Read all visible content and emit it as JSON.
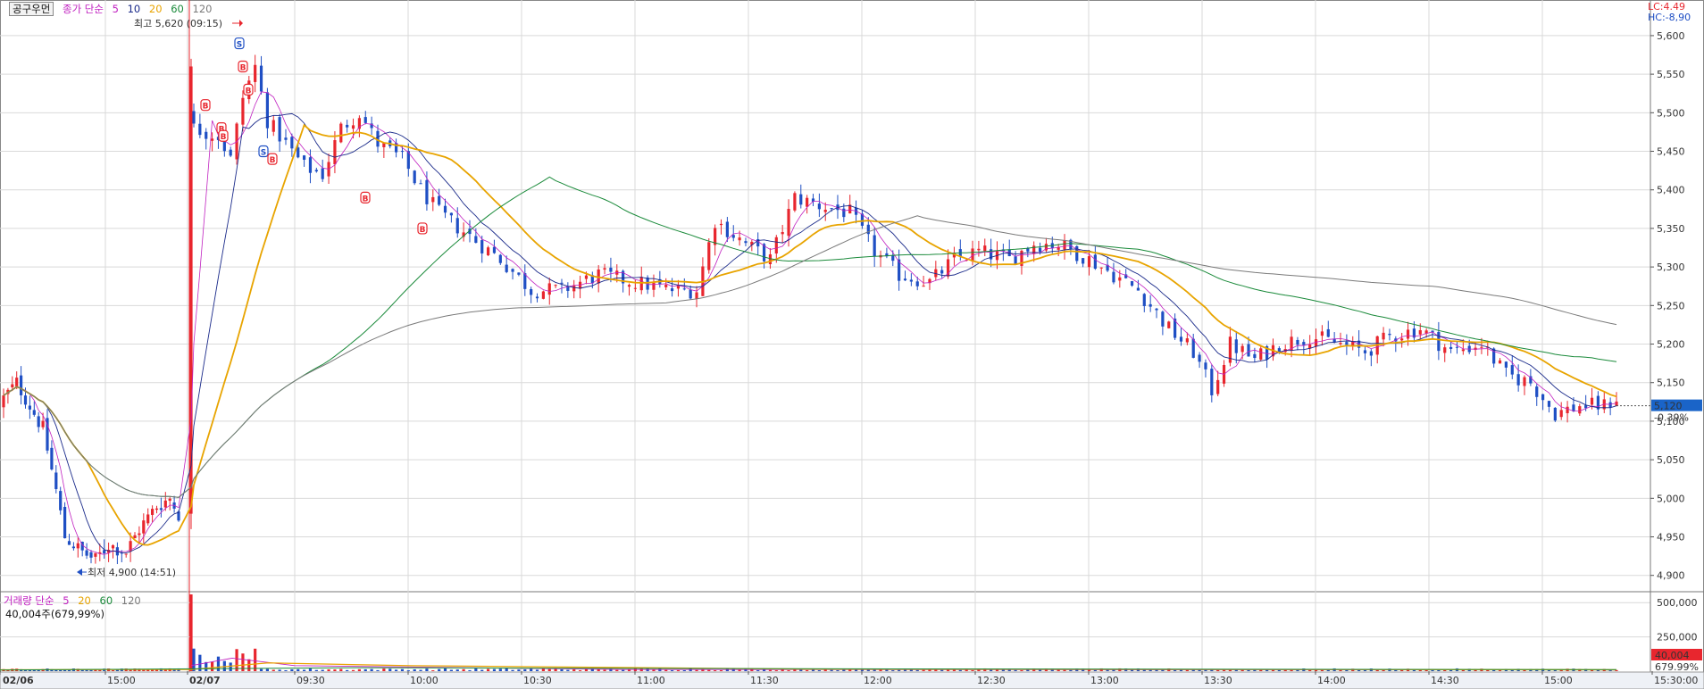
{
  "chart_data": {
    "type": "candlestick",
    "symbol": "공구우먼",
    "colors": {
      "up": "#e8262e",
      "down": "#1f4fc4",
      "ma5": "#c020c0",
      "ma10": "#1a2a8a",
      "ma20": "#e8a400",
      "ma60": "#1a8a3a",
      "ma120": "#7a7a7a",
      "grid": "#d9d9d9",
      "current_box": "#1a64c8",
      "vol_box": "#e8262e"
    },
    "price_legend": {
      "label": "종가 단순",
      "periods": [
        "5",
        "10",
        "20",
        "60",
        "120"
      ]
    },
    "volume_legend": {
      "label": "거래량 단순",
      "periods": [
        "5",
        "20",
        "60",
        "120"
      ],
      "current_text": "40,004주(679,99%)"
    },
    "y_axis": {
      "ticks": [
        "5,600",
        "5,550",
        "5,500",
        "5,450",
        "5,400",
        "5,350",
        "5,300",
        "5,250",
        "5,200",
        "5,150",
        "5,100",
        "5,050",
        "5,000",
        "4,950",
        "4,900"
      ],
      "range": [
        4880,
        5630
      ]
    },
    "vol_axis": {
      "ticks": [
        "500,000",
        "250,000"
      ],
      "range": [
        0,
        560000
      ]
    },
    "x_axis": {
      "ticks": [
        "02/06",
        "15:00",
        "02/07",
        "09:30",
        "10:00",
        "10:30",
        "11:00",
        "11:30",
        "12:00",
        "12:30",
        "13:00",
        "13:30",
        "14:00",
        "14:30",
        "15:00",
        "15:30:00"
      ]
    },
    "annotations": {
      "high": "최고 5,620 (09:15)",
      "low": "최저 4,900 (14:51)",
      "lc": "LC:4.49",
      "hc": "HC:-8,90",
      "current_price": "5,120",
      "current_change": "-0.39%",
      "current_volume": "40,004",
      "current_volume_pct": "679.99%"
    },
    "signals": {
      "buy": "B",
      "sell": "S"
    },
    "waypoints_day1": [
      [
        0,
        5130
      ],
      [
        3,
        5150
      ],
      [
        6,
        5120
      ],
      [
        9,
        5090
      ],
      [
        12,
        5010
      ],
      [
        14,
        4950
      ],
      [
        18,
        4930
      ],
      [
        21,
        4920
      ],
      [
        24,
        4940
      ],
      [
        28,
        4930
      ],
      [
        31,
        4960
      ],
      [
        35,
        4990
      ],
      [
        38,
        5000
      ],
      [
        40,
        4980
      ]
    ],
    "waypoints_day2": [
      [
        0,
        5480
      ],
      [
        4,
        5470
      ],
      [
        6,
        5440
      ],
      [
        8,
        5520
      ],
      [
        10,
        5560
      ],
      [
        12,
        5490
      ],
      [
        14,
        5470
      ],
      [
        18,
        5430
      ],
      [
        21,
        5420
      ],
      [
        24,
        5480
      ],
      [
        27,
        5500
      ],
      [
        30,
        5460
      ],
      [
        34,
        5440
      ],
      [
        37,
        5400
      ],
      [
        40,
        5370
      ],
      [
        45,
        5340
      ],
      [
        50,
        5310
      ],
      [
        55,
        5270
      ],
      [
        60,
        5270
      ],
      [
        66,
        5290
      ],
      [
        72,
        5280
      ],
      [
        78,
        5270
      ],
      [
        82,
        5270
      ],
      [
        85,
        5360
      ],
      [
        90,
        5330
      ],
      [
        94,
        5310
      ],
      [
        98,
        5390
      ],
      [
        102,
        5380
      ],
      [
        107,
        5370
      ],
      [
        111,
        5320
      ],
      [
        115,
        5290
      ],
      [
        120,
        5280
      ],
      [
        124,
        5310
      ],
      [
        128,
        5320
      ],
      [
        133,
        5310
      ],
      [
        137,
        5330
      ],
      [
        141,
        5330
      ],
      [
        146,
        5310
      ],
      [
        150,
        5290
      ],
      [
        154,
        5270
      ],
      [
        159,
        5220
      ],
      [
        163,
        5190
      ],
      [
        166,
        5140
      ],
      [
        169,
        5200
      ],
      [
        173,
        5180
      ],
      [
        177,
        5200
      ],
      [
        182,
        5210
      ],
      [
        187,
        5200
      ],
      [
        191,
        5190
      ],
      [
        195,
        5210
      ],
      [
        200,
        5220
      ],
      [
        205,
        5190
      ],
      [
        210,
        5200
      ],
      [
        214,
        5160
      ],
      [
        218,
        5150
      ],
      [
        222,
        5110
      ],
      [
        226,
        5120
      ],
      [
        230,
        5120
      ],
      [
        232,
        5130
      ]
    ]
  }
}
